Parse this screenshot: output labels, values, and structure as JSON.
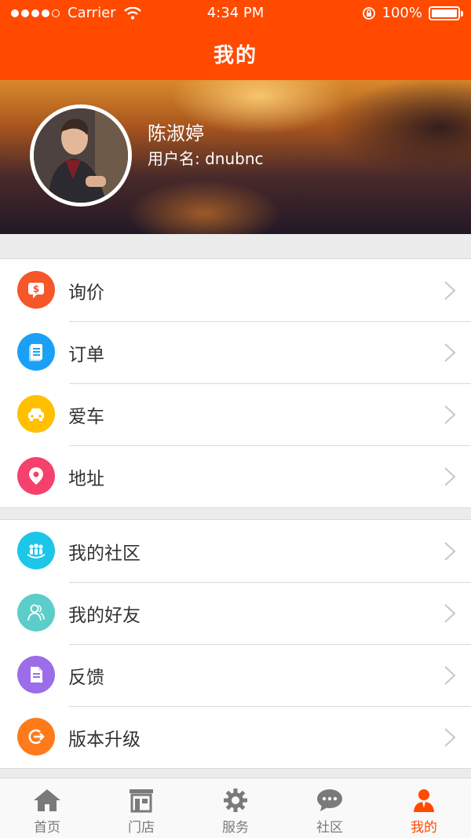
{
  "status_bar": {
    "carrier": "Carrier",
    "time": "4:34 PM",
    "battery": "100%",
    "battery_level": 1.0
  },
  "nav": {
    "title": "我的"
  },
  "profile": {
    "name": "陈淑婷",
    "username": "用户名: dnubnc"
  },
  "menu_group_1": [
    {
      "label": "询价",
      "icon": "price-tag-icon",
      "color": "#f5572a"
    },
    {
      "label": "订单",
      "icon": "document-icon",
      "color": "#1aa1f5"
    },
    {
      "label": "爱车",
      "icon": "car-icon",
      "color": "#ffc000"
    },
    {
      "label": "地址",
      "icon": "location-pin-icon",
      "color": "#f5416c"
    }
  ],
  "menu_group_2": [
    {
      "label": "我的社区",
      "icon": "community-icon",
      "color": "#1cc6e8"
    },
    {
      "label": "我的好友",
      "icon": "friend-icon",
      "color": "#5ccdc9"
    },
    {
      "label": "反馈",
      "icon": "feedback-icon",
      "color": "#9b6de8"
    },
    {
      "label": "版本升级",
      "icon": "upgrade-icon",
      "color": "#ff7a1a"
    }
  ],
  "tabs": [
    {
      "label": "首页",
      "icon": "home-icon",
      "active": false
    },
    {
      "label": "门店",
      "icon": "store-icon",
      "active": false
    },
    {
      "label": "服务",
      "icon": "gear-icon",
      "active": false
    },
    {
      "label": "社区",
      "icon": "chat-bubble-icon",
      "active": false
    },
    {
      "label": "我的",
      "icon": "user-icon",
      "active": true
    }
  ],
  "colors": {
    "accent": "#ff4a00",
    "tab_inactive": "#7a7a7a",
    "background": "#ececec"
  }
}
